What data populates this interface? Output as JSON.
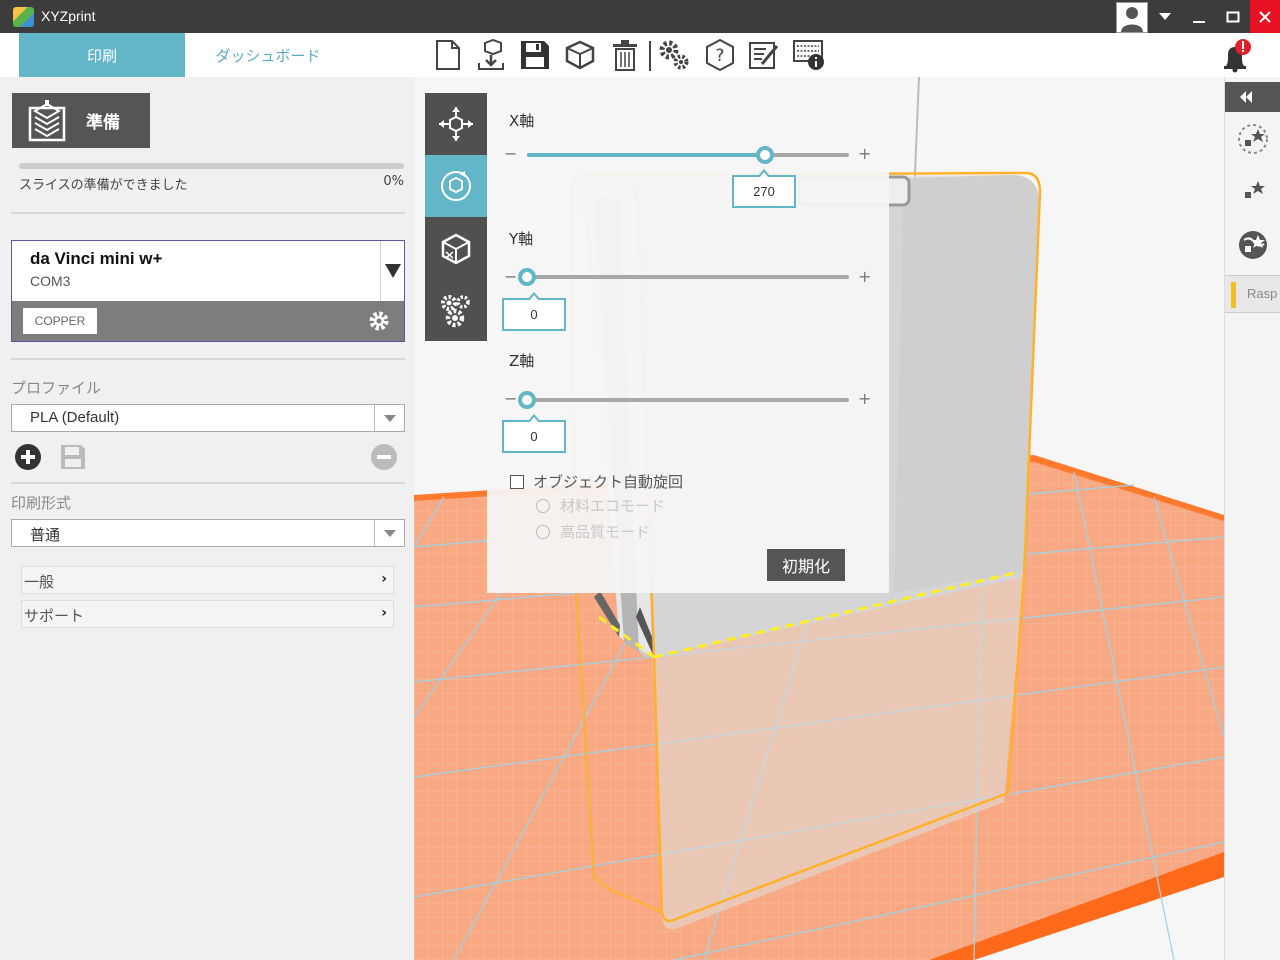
{
  "window": {
    "title": "XYZprint"
  },
  "nav": {
    "tab_print": "印刷",
    "tab_dashboard": "ダッシュボード"
  },
  "left": {
    "prepare_label": "準備",
    "slice_status": "スライスの準備ができました",
    "slice_progress": "0%",
    "printer": {
      "name": "da Vinci mini w+",
      "port": "COM3",
      "filament": "COPPER"
    },
    "profile_label": "プロファイル",
    "profile_value": "PLA (Default)",
    "print_mode_label": "印刷形式",
    "print_mode_value": "普通",
    "general_label": "一般",
    "support_label": "サポート"
  },
  "rotate": {
    "x_label": "X軸",
    "x_value": "270",
    "y_label": "Y軸",
    "y_value": "0",
    "z_label": "Z軸",
    "z_value": "0",
    "minus": "−",
    "plus": "+",
    "auto_rotate_label": "オブジェクト自動旋回",
    "material_eco_label": "材料エコモード",
    "quality_label": "高品質モード",
    "reset_label": "初期化",
    "x_slider_fraction": 0.74,
    "y_slider_fraction": 0.0,
    "z_slider_fraction": 0.0
  },
  "right": {
    "tab_label": "Rasp"
  },
  "colors": {
    "accent": "#62b6c8",
    "bed": "#f8a882",
    "bed_edge": "#ff6a1a",
    "grid": "#9fd3e6",
    "object_outline": "#ffb12a"
  }
}
